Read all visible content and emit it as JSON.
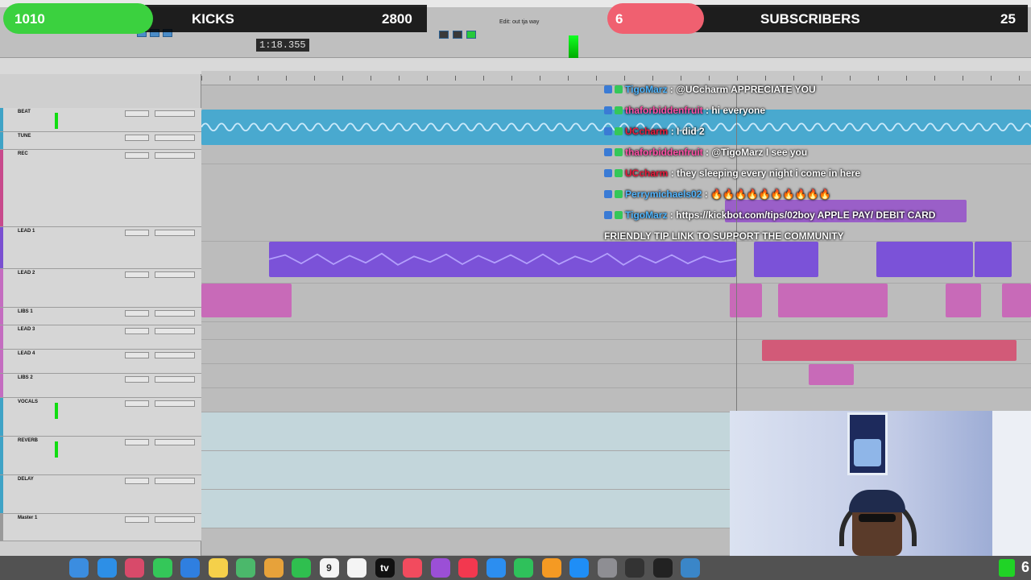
{
  "banner": {
    "kicks_count": "1010",
    "kicks_label": "KICKS",
    "kicks_goal": "2800",
    "subs_count": "6",
    "subs_label": "SUBSCRIBERS",
    "subs_goal": "25"
  },
  "transport": {
    "counter": "1:18.355",
    "edit_title": "Edit: out tja way"
  },
  "tracks": [
    {
      "name": "BEAT",
      "color": "#3fa3c6"
    },
    {
      "name": "TUNE",
      "color": "#3fa3c6"
    },
    {
      "name": "REC",
      "color": "#c84a8c"
    },
    {
      "name": "LEAD 1",
      "color": "#7a4fd1"
    },
    {
      "name": "LEAD 2",
      "color": "#c46cc0"
    },
    {
      "name": "LIBS 1",
      "color": "#c46cc0"
    },
    {
      "name": "LEAD 3",
      "color": "#c46cc0"
    },
    {
      "name": "LEAD 4",
      "color": "#c46cc0"
    },
    {
      "name": "LIBS 2",
      "color": "#c46cc0"
    },
    {
      "name": "VOCALS",
      "color": "#3fa3c6"
    },
    {
      "name": "REVERB",
      "color": "#3fa3c6"
    },
    {
      "name": "DELAY",
      "color": "#3fa3c6"
    },
    {
      "name": "Master 1",
      "color": "#999999"
    }
  ],
  "chat": [
    {
      "user": "TigoMarz",
      "user_color": "#4fb6ff",
      "text": ": @UCcharm APPRECIATE YOU"
    },
    {
      "user": "thaforbiddenfruit",
      "user_color": "#ff4fa6",
      "text": ": hi everyone"
    },
    {
      "user": "UCcharm",
      "user_color": "#e81a3a",
      "text": ": I did 2"
    },
    {
      "user": "thaforbiddenfruit",
      "user_color": "#ff4fa6",
      "text": ": @TigoMarz I see you"
    },
    {
      "user": "UCcharm",
      "user_color": "#e81a3a",
      "text": ": they sleeping every night i come in here"
    },
    {
      "user": "Perrymichaels02",
      "user_color": "#53b6ff",
      "text": ": 🔥🔥🔥🔥🔥🔥🔥🔥🔥🔥"
    },
    {
      "user": "TigoMarz",
      "user_color": "#4fb6ff",
      "text": ": https://kickbot.com/tips/02boy APPLE PAY/ DEBIT CARD"
    },
    {
      "user": "",
      "user_color": "#ffffff",
      "text": "FRIENDLY TIP LINK TO SUPPORT THE COMMUNITY"
    }
  ],
  "dock": {
    "calendar_day": "9",
    "tv_label": "tv",
    "kick_badge": "6",
    "apps": [
      {
        "name": "finder",
        "color": "#3b8de0"
      },
      {
        "name": "safari",
        "color": "#2d8fe6"
      },
      {
        "name": "launchpad",
        "color": "#d84a6a"
      },
      {
        "name": "messages",
        "color": "#34c759"
      },
      {
        "name": "mail",
        "color": "#2f7fe0"
      },
      {
        "name": "notes",
        "color": "#f5d04a"
      },
      {
        "name": "maps",
        "color": "#4bb86b"
      },
      {
        "name": "photos",
        "color": "#e7a23a"
      },
      {
        "name": "facetime",
        "color": "#2fbf4f"
      },
      {
        "name": "calendar",
        "color": "#f4f4f4"
      },
      {
        "name": "reminders",
        "color": "#f4f4f4"
      },
      {
        "name": "tv",
        "color": "#111111"
      },
      {
        "name": "music",
        "color": "#f24b5e"
      },
      {
        "name": "podcasts",
        "color": "#9b4fd6"
      },
      {
        "name": "news",
        "color": "#f2384f"
      },
      {
        "name": "keynote",
        "color": "#2c8ef0"
      },
      {
        "name": "numbers",
        "color": "#2fc15b"
      },
      {
        "name": "pages",
        "color": "#f59a23"
      },
      {
        "name": "app-store",
        "color": "#1f8ef6"
      },
      {
        "name": "system-settings",
        "color": "#8e8e93"
      },
      {
        "name": "logic",
        "color": "#333333"
      },
      {
        "name": "uad",
        "color": "#222222"
      },
      {
        "name": "obs",
        "color": "#3a86c8"
      }
    ]
  }
}
